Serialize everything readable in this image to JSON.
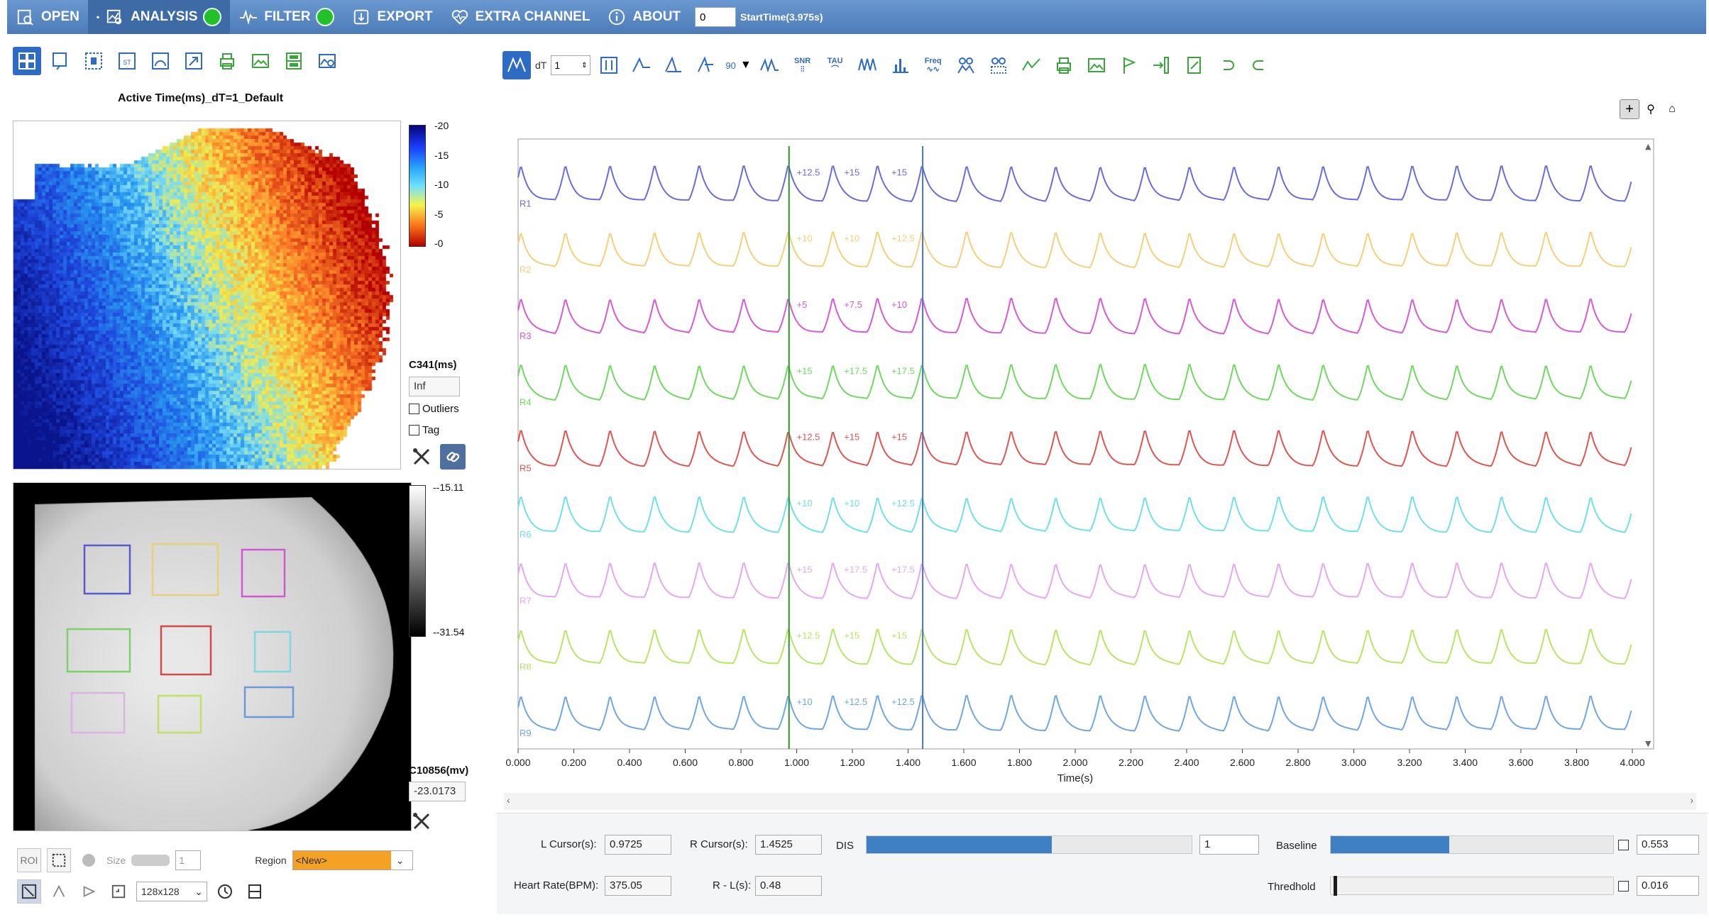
{
  "menubar": {
    "open": "OPEN",
    "analysis": "ANALYSIS",
    "filter": "FILTER",
    "export": "EXPORT",
    "extra_channel": "EXTRA CHANNEL",
    "about": "ABOUT",
    "start_value": "0",
    "start_time_label": "StartTime(3.975s)"
  },
  "left": {
    "map_title": "Active Time(ms)_dT=1_Default",
    "top_colorbar_ticks": [
      "-20",
      "-15",
      "-10",
      "-5",
      "-0"
    ],
    "bottom_colorbar_ticks": [
      "--15.11",
      "--31.54"
    ],
    "c341_label": "C341(ms)",
    "c341_value": "Inf",
    "outliers_label": "Outliers",
    "tag_label": "Tag",
    "c10856_label": "C10856(mv)",
    "c10856_value": "-23.0173",
    "roi_label": "ROI",
    "size_label": "Size",
    "size_value": "1",
    "region_label": "Region",
    "region_value": "<New>",
    "resolution_value": "128x128"
  },
  "right": {
    "dt_label": "dT",
    "dt_value": "1",
    "spin_value": "90",
    "freq_label": "Freq",
    "snr_label": "SNR",
    "tau_label": "TAU",
    "l_cursor_label": "L Cursor(s):",
    "l_cursor_value": "0.9725",
    "r_cursor_label": "R Cursor(s):",
    "r_cursor_value": "1.4525",
    "dis_label": "DIS",
    "dis_value": "1",
    "baseline_label": "Baseline",
    "baseline_value": "0.553",
    "heart_rate_label": "Heart Rate(BPM):",
    "heart_rate_value": "375.05",
    "rl_label": "R - L(s):",
    "rl_value": "0.48",
    "threshold_label": "Thredhold",
    "threshold_value": "0.016",
    "dis_fraction": 0.57,
    "baseline_fraction": 0.42,
    "threshold_fraction": 0.01
  },
  "chart_data": {
    "type": "line",
    "xlabel": "Time(s)",
    "xlim": [
      0,
      4.0
    ],
    "x_ticks": [
      "0.000",
      "0.200",
      "0.400",
      "0.600",
      "0.800",
      "1.000",
      "1.200",
      "1.400",
      "1.600",
      "1.800",
      "2.000",
      "2.200",
      "2.400",
      "2.600",
      "2.800",
      "3.000",
      "3.200",
      "3.400",
      "3.600",
      "3.800",
      "4.000"
    ],
    "l_cursor": 0.9725,
    "r_cursor": 1.4525,
    "beat_period": 0.16,
    "beats": 25,
    "series": [
      {
        "name": "R1",
        "color": "#6b6be0",
        "markers": [
          "12.5",
          "15",
          "15"
        ]
      },
      {
        "name": "R2",
        "color": "#f5cf7a",
        "markers": [
          "10",
          "10",
          "12.5"
        ]
      },
      {
        "name": "R3",
        "color": "#d65ad6",
        "markers": [
          "5",
          "7.5",
          "10"
        ]
      },
      {
        "name": "R4",
        "color": "#6fd95f",
        "markers": [
          "15",
          "17.5",
          "17.5"
        ]
      },
      {
        "name": "R5",
        "color": "#e0554f",
        "markers": [
          "12.5",
          "15",
          "15"
        ]
      },
      {
        "name": "R6",
        "color": "#6fe0e8",
        "markers": [
          "10",
          "10",
          "12.5"
        ]
      },
      {
        "name": "R7",
        "color": "#e4a8f0",
        "markers": [
          "15",
          "17.5",
          "17.5"
        ]
      },
      {
        "name": "R8",
        "color": "#b6e664",
        "markers": [
          "12.5",
          "15",
          "15"
        ]
      },
      {
        "name": "R9",
        "color": "#6fa6e6",
        "markers": [
          "10",
          "12.5",
          "12.5"
        ]
      }
    ]
  },
  "rois": [
    {
      "color": "#5a5ad0"
    },
    {
      "color": "#e8cf7a"
    },
    {
      "color": "#cf5ad0"
    },
    {
      "color": "#7fd06a"
    },
    {
      "color": "#d04a4a"
    },
    {
      "color": "#7fd8e0"
    },
    {
      "color": "#e0b0e8"
    },
    {
      "color": "#c0e068"
    },
    {
      "color": "#6a9ad8"
    }
  ]
}
